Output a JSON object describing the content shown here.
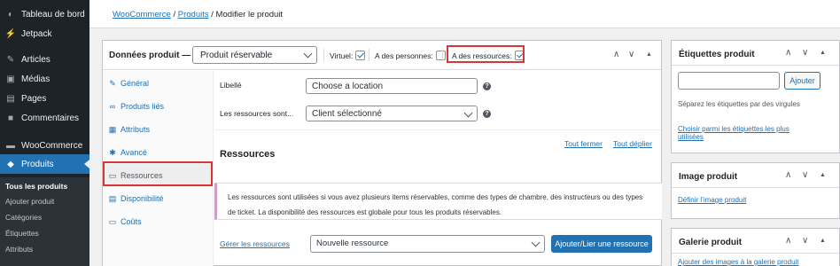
{
  "sidebar": {
    "items": [
      {
        "label": "Tableau de bord",
        "icon": "dashboard-icon",
        "glyph": "◐"
      },
      {
        "label": "Jetpack",
        "icon": "jetpack-icon",
        "glyph": "⚡"
      },
      {
        "label": "Articles",
        "icon": "pin-icon",
        "glyph": "✎"
      },
      {
        "label": "Médias",
        "icon": "media-icon",
        "glyph": "▣"
      },
      {
        "label": "Pages",
        "icon": "pages-icon",
        "glyph": "▤"
      },
      {
        "label": "Commentaires",
        "icon": "comments-icon",
        "glyph": "■"
      },
      {
        "label": "WooCommerce",
        "icon": "woocommerce-icon",
        "glyph": "▬"
      },
      {
        "label": "Produits",
        "icon": "products-icon",
        "glyph": "◆"
      }
    ],
    "submenu": [
      "Tous les produits",
      "Ajouter produit",
      "Catégories",
      "Étiquettes",
      "Attributs"
    ]
  },
  "breadcrumb": {
    "link1": "WooCommerce",
    "link2": "Produits",
    "current": "Modifier le produit",
    "sep": "/"
  },
  "product_data": {
    "title": "Données produit —",
    "type_select": "Produit réservable",
    "virtual_label": "Virtuel:",
    "virtual_checked": true,
    "persons_label": "A des personnes:",
    "persons_checked": false,
    "resources_label": "A des ressources:",
    "resources_checked": true,
    "ctrl_up": "∧",
    "ctrl_down": "∨",
    "ctrl_toggle": "▲"
  },
  "tabs": [
    {
      "label": "Général",
      "icon": "wrench-icon",
      "glyph": "✎"
    },
    {
      "label": "Produits liés",
      "icon": "link-icon",
      "glyph": "∞"
    },
    {
      "label": "Attributs",
      "icon": "list-icon",
      "glyph": "▦"
    },
    {
      "label": "Avancé",
      "icon": "gear-icon",
      "glyph": "✱"
    },
    {
      "label": "Ressources",
      "icon": "calendar-icon",
      "glyph": "▭"
    },
    {
      "label": "Disponibilité",
      "icon": "calendar-icon",
      "glyph": "▤"
    },
    {
      "label": "Coûts",
      "icon": "money-icon",
      "glyph": "▭"
    }
  ],
  "fields": {
    "libelle_label": "Libellé",
    "libelle_value": "Choose a location",
    "resources_label": "Les ressources sont...",
    "resources_value": "Client sélectionné",
    "help": "?"
  },
  "resources": {
    "title": "Ressources",
    "close_all": "Tout fermer",
    "expand_all": "Tout déplier",
    "info_line1": "Les ressources sont utilisées si vous avez plusieurs items réservables, comme des types de chambre, des instructeurs ou des types",
    "info_line2": "de ticket. La disponibilité des ressources est globale pour tous les produits réservables.",
    "manage_link": "Gérer les ressources",
    "new_select": "Nouvelle ressource",
    "add_button": "Ajouter/Lier une ressource"
  },
  "tags_box": {
    "title": "Étiquettes produit",
    "add_button": "Ajouter",
    "hint": "Séparez les étiquettes par des virgules",
    "choose_line1": "Choisir parmi les étiquettes les plus",
    "choose_line2": "utilisées"
  },
  "image_box": {
    "title": "Image produit",
    "set_link": "Définir l’image produit"
  },
  "gallery_box": {
    "title": "Galerie produit",
    "add_link": "Ajouter des images à la galerie produit"
  },
  "colors": {
    "admin_bar": "#1d2327",
    "accent": "#2271b1",
    "highlight": "#d63638"
  }
}
